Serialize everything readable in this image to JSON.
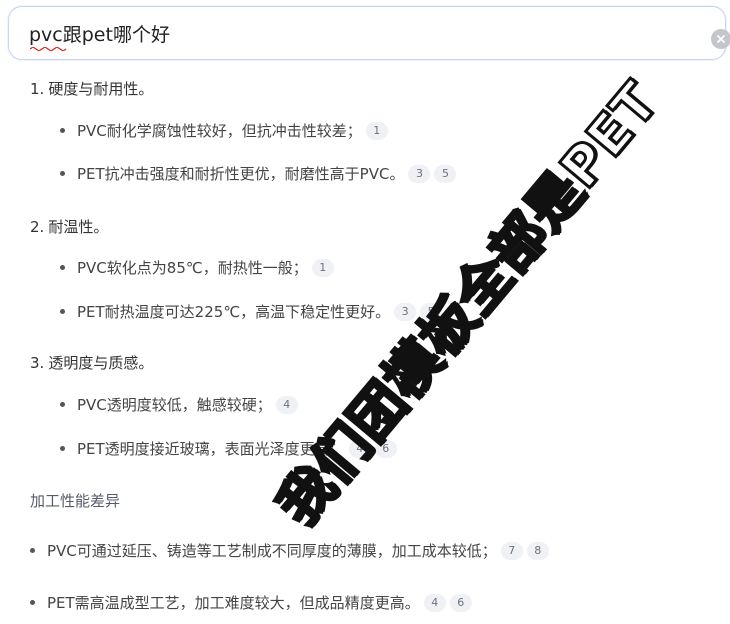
{
  "search": {
    "query": "pvc跟pet哪个好"
  },
  "sections": [
    {
      "num": "1.",
      "title": "硬度与耐用性。",
      "bullets": [
        {
          "text": "PVC耐化学腐蚀性较好，但抗冲击性较差；",
          "cites": [
            "1"
          ]
        },
        {
          "text": "PET抗冲击强度和耐折性更优，耐磨性高于PVC。",
          "cites": [
            "3",
            "5"
          ]
        }
      ]
    },
    {
      "num": "2.",
      "title": "耐温性。",
      "bullets": [
        {
          "text": "PVC软化点为85℃，耐热性一般；",
          "cites": [
            "1"
          ]
        },
        {
          "text": "PET耐热温度可达225℃，高温下稳定性更好。",
          "cites": [
            "3",
            "5"
          ]
        }
      ]
    },
    {
      "num": "3.",
      "title": "透明度与质感。",
      "bullets": [
        {
          "text": "PVC透明度较低，触感较硬；",
          "cites": [
            "4"
          ]
        },
        {
          "text": "PET透明度接近玻璃，表面光泽度更高。",
          "cites": [
            "4",
            "6"
          ]
        }
      ]
    }
  ],
  "processing": {
    "title": "加工性能差异",
    "bullets": [
      {
        "text": "PVC可通过延压、铸造等工艺制成不同厚度的薄膜，加工成本较低；",
        "cites": [
          "7",
          "8"
        ]
      },
      {
        "text": "PET需高温成型工艺，加工难度较大，但成品精度更高。",
        "cites": [
          "4",
          "6"
        ]
      }
    ]
  },
  "watermark": {
    "text": "我们团模板全部是PET"
  },
  "colors": {
    "spellcheck": "#e02020",
    "search_border": "#c8d4f0",
    "cite_bg": "#eff1f5"
  },
  "icons": {
    "clear": "close-circle-icon",
    "bullet": "bullet-dot"
  }
}
